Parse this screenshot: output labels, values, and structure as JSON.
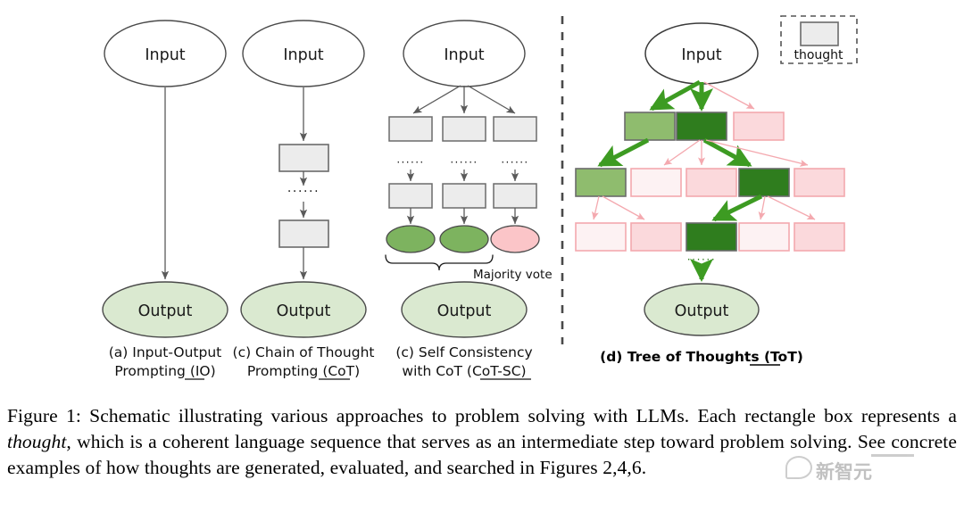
{
  "figure": {
    "panels": [
      {
        "id": "io",
        "label_line1": "(a) Input-Output",
        "label_line2": "Prompting (IO)",
        "label_underline": "IO",
        "input_text": "Input",
        "output_text": "Output"
      },
      {
        "id": "cot",
        "label_line1": "(c) Chain of Thought",
        "label_line2": "Prompting (CoT)",
        "label_underline": "CoT",
        "input_text": "Input",
        "output_text": "Output",
        "ellipsis": "······"
      },
      {
        "id": "cot-sc",
        "label_line1": "(c) Self Consistency",
        "label_line2": "with CoT (CoT-SC)",
        "label_underline": "CoT-SC",
        "input_text": "Input",
        "output_text": "Output",
        "ellipsis": "······",
        "majority_vote_label": "Majority vote",
        "branch_outcomes": [
          "green",
          "green",
          "pink"
        ]
      },
      {
        "id": "tot",
        "label": "(d) Tree of Thoughts (ToT)",
        "label_underline": "ToT",
        "input_text": "Input",
        "output_text": "Output",
        "ellipsis": "······",
        "tree_levels": [
          [
            "light-green",
            "dark-green",
            "pink"
          ],
          [
            "light-green",
            "pale-pink",
            "pink",
            "dark-green",
            "pink"
          ],
          [
            "pale-pink",
            "pink",
            "dark-green",
            "pale-pink",
            "pink"
          ]
        ]
      }
    ],
    "legend": {
      "swatch_label": "thought"
    },
    "caption": {
      "line1": "Figure 1: Schematic illustrating various approaches to problem solving with LLMs. Each rectangle",
      "line2_a": "box represents a ",
      "line2_italic": "thought",
      "line2_b": ", which is a coherent language sequence that serves as an intermediate",
      "line3": "step toward problem solving. See concrete examples of how thoughts are generated, evaluated, and",
      "line4": "searched in Figures 2,4,6."
    },
    "watermark": {
      "text": "新智元"
    },
    "colors": {
      "thought_box_fill": "#ececec",
      "thought_box_stroke": "#6b6b6b",
      "output_oval_fill": "#dae9d0",
      "oval_stroke": "#4a4a4a",
      "green_oval_fill": "#7db35f",
      "pink_oval_fill": "#fbc5c8",
      "light_green": "#8fbc6e",
      "dark_green": "#2f7d1e",
      "pink": "#fbd9dc",
      "pale_pink": "#fdf2f3",
      "pink_stroke": "#f3a8ae",
      "green_arrow": "#3d9b22",
      "pink_arrow": "#f4a9af",
      "divider": "#4a4a4a",
      "arrow_gray": "#5a5a5a"
    }
  }
}
